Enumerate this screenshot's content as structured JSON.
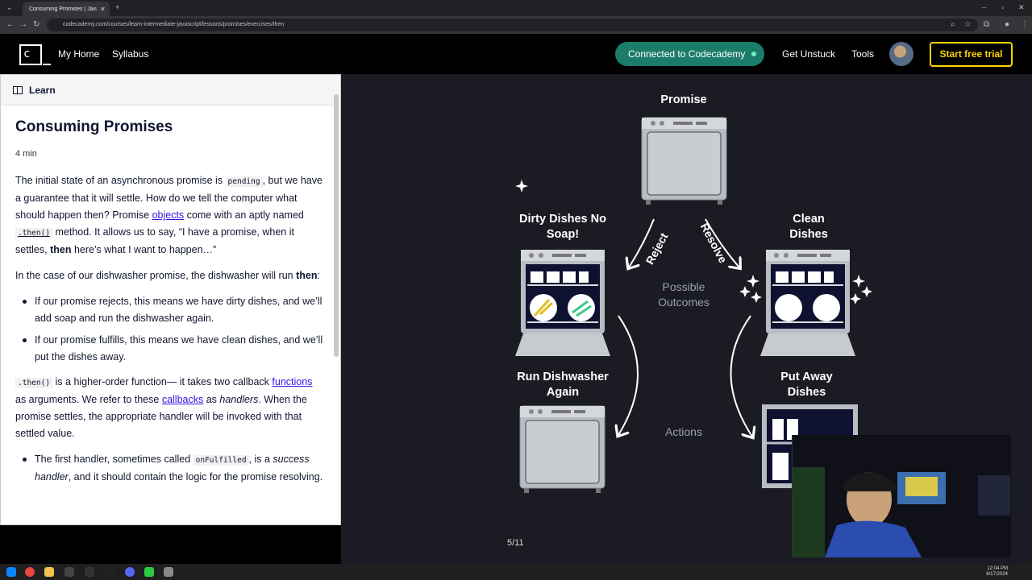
{
  "browser": {
    "tab_title": "Consuming Promises | JavaScri...",
    "url": "codecademy.com/courses/learn-intermediate-javascript/lessons/promises/exercises/then"
  },
  "header": {
    "logo_text": "c",
    "nav": [
      "My Home",
      "Syllabus"
    ],
    "connected_label": "Connected to Codecademy",
    "get_unstuck": "Get Unstuck",
    "tools": "Tools",
    "start_trial": "Start free trial",
    "colors": {
      "connected": "#1c7c6a",
      "trial": "#ffd300"
    }
  },
  "learn": {
    "tab_label": "Learn",
    "title": "Consuming Promises",
    "read_time": "4 min",
    "p1": {
      "t1": "The initial state of an asynchronous promise is ",
      "code1": "pending",
      "t2": ", but we have a guarantee that it will settle. How do we tell the computer what should happen then? Promise ",
      "link1": "objects",
      "t3": " come with an aptly named ",
      "code2": ".then()",
      "t4": " method. It allows us to say, “I have a promise, when it settles, ",
      "bold1": "then",
      "t5": " here’s what I want to happen…”"
    },
    "p2": {
      "t1": "In the case of our dishwasher promise, the dishwasher will run ",
      "bold1": "then",
      "t2": ":"
    },
    "bullets1": [
      "If our promise rejects, this means we have dirty dishes, and we’ll add soap and run the dishwasher again.",
      "If our promise fulfills, this means we have clean dishes, and we’ll put the dishes away."
    ],
    "p3": {
      "code1": ".then()",
      "t1": " is a higher-order function— it takes two callback ",
      "link1": "functions",
      "t2": " as arguments. We refer to these ",
      "link2": "callbacks",
      "t3": " as ",
      "em1": "handlers",
      "t4": ". When the promise settles, the appropriate handler will be invoked with that settled value."
    },
    "bullet2": {
      "t1": "The first handler, sometimes called ",
      "code1": "onFulfilled",
      "t2": ", is a ",
      "em1": "success handler",
      "t3": ", and it should contain the logic for the promise resolving."
    }
  },
  "diagram": {
    "promise": "Promise",
    "dirty": "Dirty Dishes No Soap!",
    "clean": "Clean Dishes",
    "reject": "Reject",
    "resolve": "Resolve",
    "possible": "Possible Outcomes",
    "run_again": "Run Dishwasher Again",
    "put_away": "Put Away Dishes",
    "actions": "Actions"
  },
  "page_counter": "5/11",
  "taskbar": {
    "time": "12:04 PM",
    "date": "8/17/2024"
  }
}
